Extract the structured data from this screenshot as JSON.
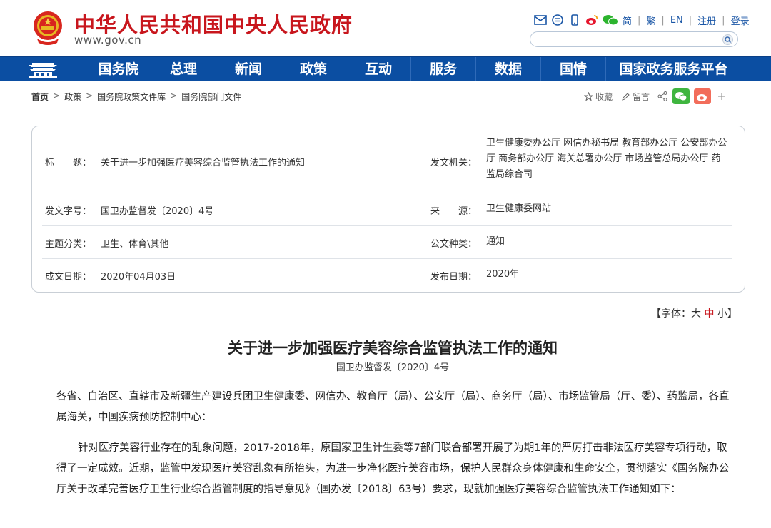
{
  "header": {
    "site_title": "中华人民共和国中央人民政府",
    "site_url": "www.gov.cn",
    "top_links": [
      "简",
      "繁",
      "EN",
      "注册",
      "登录"
    ],
    "search_placeholder": ""
  },
  "nav": {
    "items": [
      "国务院",
      "总理",
      "新闻",
      "政策",
      "互动",
      "服务",
      "数据",
      "国情",
      "国家政务服务平台"
    ]
  },
  "breadcrumb": [
    "首页",
    "政策",
    "国务院政策文件库",
    "国务院部门文件"
  ],
  "share": {
    "favorite": "收藏",
    "comment": "留言"
  },
  "info": {
    "title_label": "标　　题：",
    "title_value": "关于进一步加强医疗美容综合监管执法工作的通知",
    "issuer_label": "发文机关：",
    "issuer_value": "卫生健康委办公厅 网信办秘书局 教育部办公厅 公安部办公厅 商务部办公厅 海关总署办公厅 市场监管总局办公厅 药监局综合司",
    "docno_label": "发文字号：",
    "docno_value": "国卫办监督发〔2020〕4号",
    "source_label": "来　　源：",
    "source_value": "卫生健康委网站",
    "topic_label": "主题分类：",
    "topic_value": "卫生、体育\\其他",
    "doctype_label": "公文种类：",
    "doctype_value": "通知",
    "created_label": "成文日期：",
    "created_value": "2020年04月03日",
    "published_label": "发布日期：",
    "published_value": "2020年"
  },
  "font_size": {
    "prefix": "【字体：",
    "large": "大",
    "medium": "中",
    "small": "小",
    "suffix": "】"
  },
  "article": {
    "title": "关于进一步加强医疗美容综合监管执法工作的通知",
    "doc_number": "国卫办监督发〔2020〕4号",
    "para1": "各省、自治区、直辖市及新疆生产建设兵团卫生健康委、网信办、教育厅（局）、公安厅（局）、商务厅（局）、市场监管局（厅、委）、药监局，各直属海关，中国疾病预防控制中心：",
    "para2": "针对医疗美容行业存在的乱象问题，2017-2018年，原国家卫生计生委等7部门联合部署开展了为期1年的严厉打击非法医疗美容专项行动，取得了一定成效。近期，监管中发现医疗美容乱象有所抬头，为进一步净化医疗美容市场，保护人民群众身体健康和生命安全，贯彻落实《国务院办公厅关于改革完善医疗卫生行业综合监管制度的指导意见》（国办发〔2018〕63号）要求，现就加强医疗美容综合监管执法工作通知如下："
  },
  "colors": {
    "brand_red": "#c8161d",
    "nav_blue": "#0b4ea2"
  }
}
